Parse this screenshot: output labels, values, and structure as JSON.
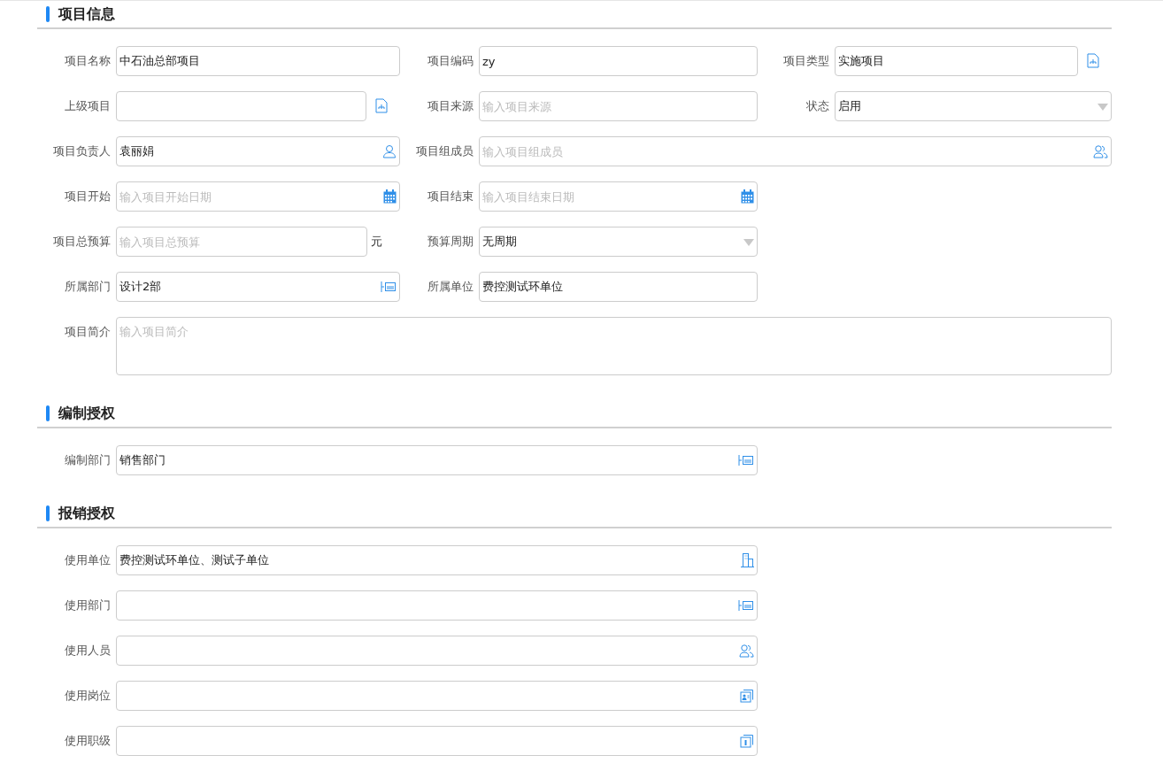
{
  "sections": [
    {
      "title": "项目信息",
      "rows": [
        [
          {
            "label": "项目名称",
            "kind": "text",
            "value": "中石油总部项目"
          },
          {
            "label": "项目编码",
            "kind": "text",
            "value": "zy"
          },
          {
            "label": "项目类型",
            "kind": "org",
            "value": "实施项目"
          }
        ],
        [
          {
            "label": "上级项目",
            "kind": "org"
          },
          {
            "label": "项目来源",
            "kind": "text",
            "placeholder": "输入项目来源"
          },
          {
            "label": "状态",
            "kind": "select",
            "value": "启用"
          }
        ],
        [
          {
            "label": "项目负责人",
            "kind": "person",
            "value": "袁丽娟"
          },
          {
            "label": "项目组成员",
            "kind": "people",
            "placeholder": "输入项目组成员"
          }
        ],
        [
          {
            "label": "项目开始",
            "kind": "date",
            "placeholder": "输入项目开始日期"
          },
          {
            "label": "项目结束",
            "kind": "date",
            "placeholder": "输入项目结束日期"
          }
        ],
        [
          {
            "label": "项目总预算",
            "kind": "amount",
            "placeholder": "输入项目总预算",
            "suffix": "元"
          },
          {
            "label": "预算周期",
            "kind": "select",
            "value": "无周期"
          }
        ],
        [
          {
            "label": "所属部门",
            "kind": "department",
            "value": "设计2部"
          },
          {
            "label": "所属单位",
            "kind": "text",
            "value": "费控测试环单位"
          }
        ],
        [
          {
            "label": "项目简介",
            "kind": "textarea",
            "placeholder": "输入项目简介"
          }
        ]
      ]
    },
    {
      "title": "编制授权",
      "rows": [
        [
          {
            "label": "编制部门",
            "kind": "department",
            "value": "销售部门"
          }
        ]
      ]
    },
    {
      "title": "报销授权",
      "rows": [
        [
          {
            "label": "使用单位",
            "kind": "building",
            "value": "费控测试环单位、测试子单位"
          }
        ],
        [
          {
            "label": "使用部门",
            "kind": "department"
          }
        ],
        [
          {
            "label": "使用人员",
            "kind": "people"
          }
        ],
        [
          {
            "label": "使用岗位",
            "kind": "position"
          }
        ],
        [
          {
            "label": "使用职级",
            "kind": "rank"
          }
        ]
      ]
    }
  ]
}
